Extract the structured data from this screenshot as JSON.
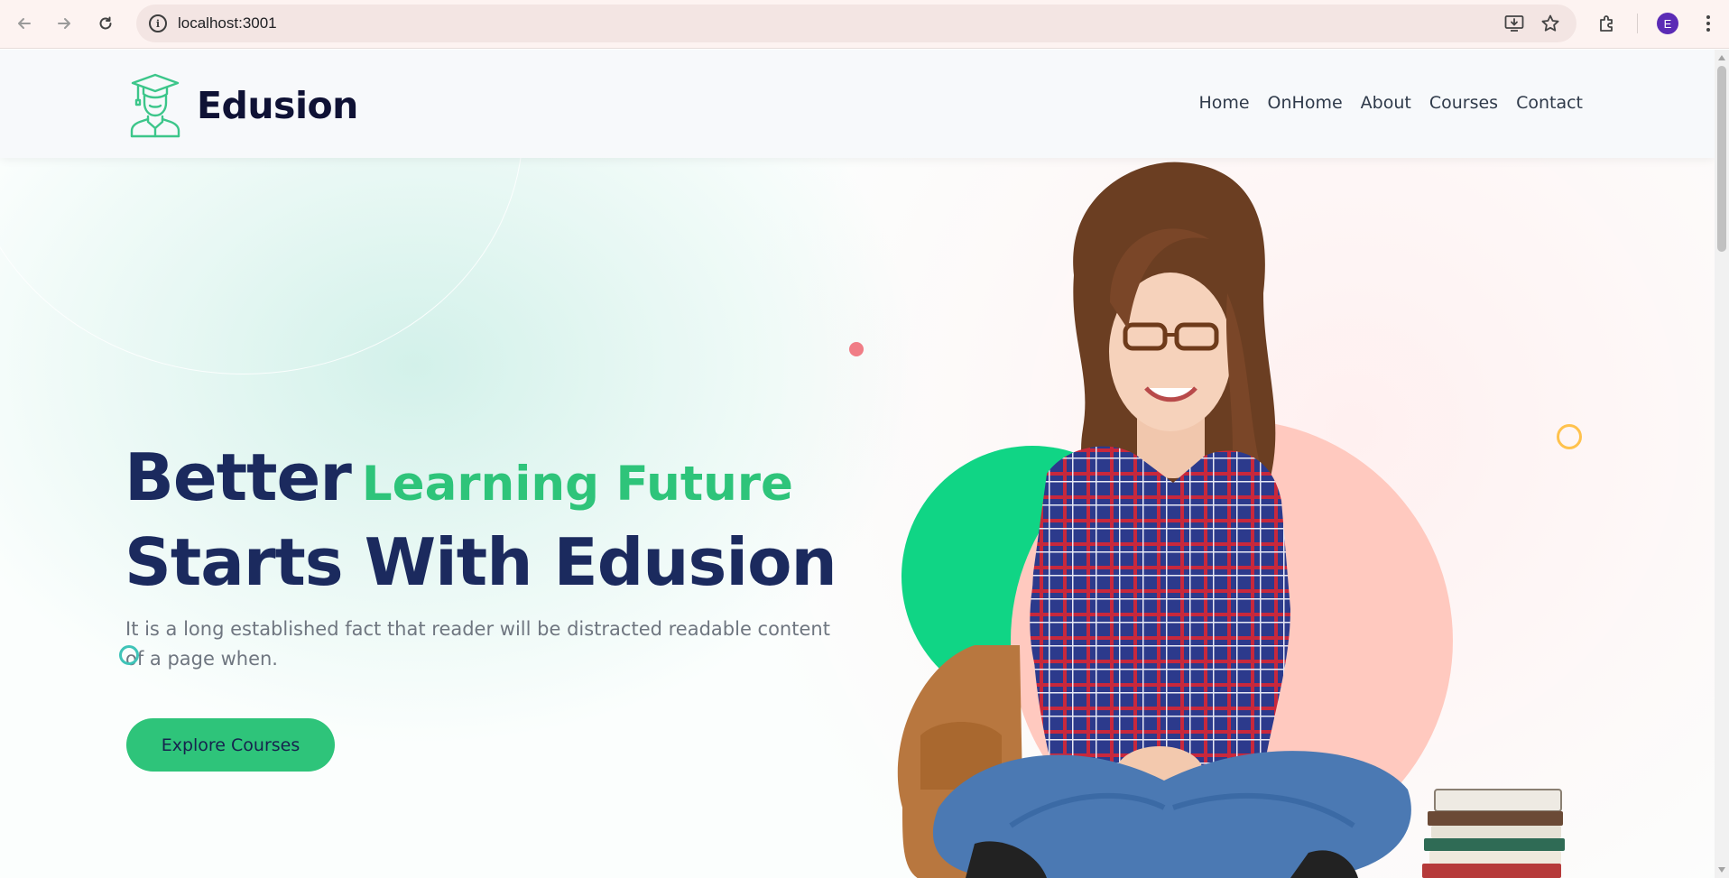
{
  "browser": {
    "url": "localhost:3001",
    "profile_initial": "E"
  },
  "site": {
    "brand": "Edusion",
    "nav": [
      "Home",
      "OnHome",
      "About",
      "Courses",
      "Contact"
    ]
  },
  "hero": {
    "headline_part1": "Better",
    "headline_highlight": "Learning Future",
    "headline_line2": "Starts With Edusion",
    "description": "It is a long established fact that reader will be distracted readable content of a page when.",
    "cta_label": "Explore Courses"
  },
  "colors": {
    "brand_green": "#2ec47a",
    "navy": "#1b2a5e",
    "circle_green": "#10d585",
    "circle_pink": "#ffc9bf",
    "dot_pink": "#f07d86",
    "ring_yellow": "#ffc24d"
  }
}
